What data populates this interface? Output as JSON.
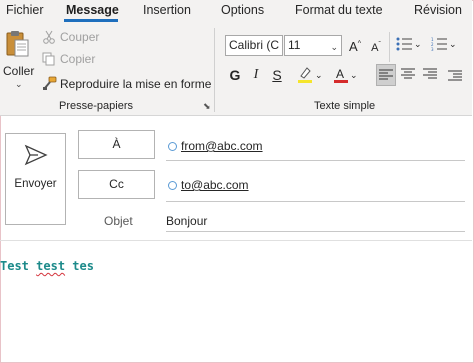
{
  "tabs": [
    "Fichier",
    "Message",
    "Insertion",
    "Options",
    "Format du texte",
    "Révision"
  ],
  "clipboard": {
    "paste_label": "Coller",
    "cut_label": "Couper",
    "copy_label": "Copier",
    "format_painter_label": "Reproduire la mise en forme",
    "group_label": "Presse-papiers"
  },
  "basic_text": {
    "font_name": "Calibri (C",
    "font_size": "11",
    "bold": "G",
    "italic": "I",
    "underline": "S",
    "group_label": "Texte simple",
    "highlight_color": "#f5e52c",
    "font_color": "#d52b2b"
  },
  "compose": {
    "send_label": "Envoyer",
    "to_button": "À",
    "cc_button": "Cc",
    "from_address": "from@abc.com",
    "to_address": "to@abc.com",
    "subject_label": "Objet",
    "subject_value": "Bonjour",
    "body_word_1": "Test",
    "body_word_2": "test",
    "body_word_3": "tes"
  }
}
